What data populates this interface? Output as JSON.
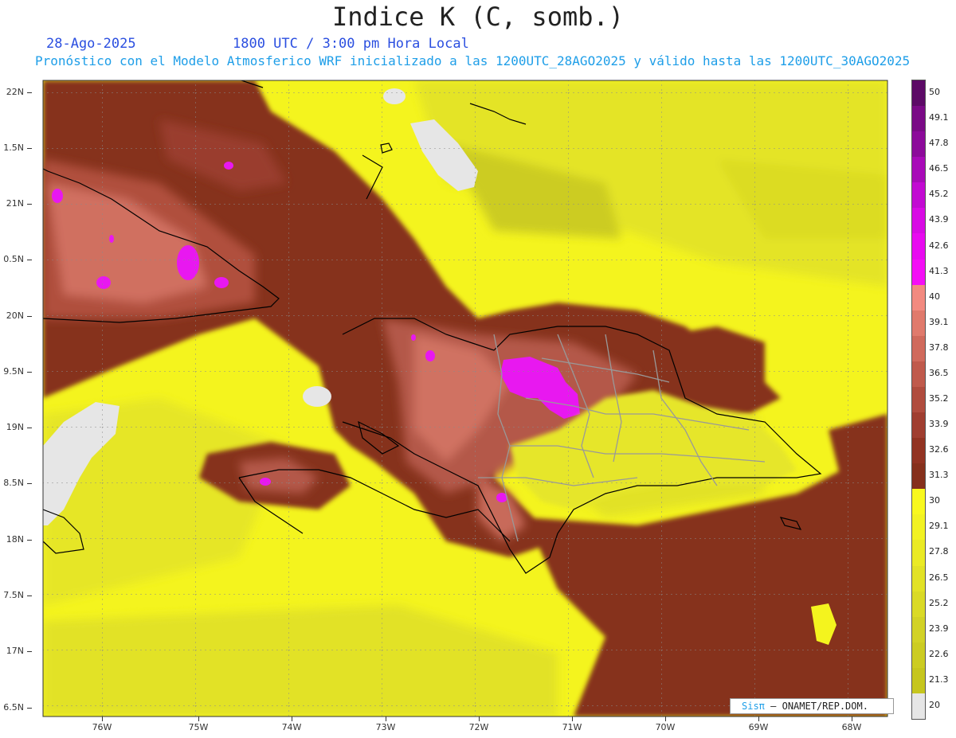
{
  "header": {
    "title": "Indice K (C, somb.)",
    "date": "28-Ago-2025",
    "time": "1800 UTC / 3:00 pm Hora Local",
    "subtitle": "Pronóstico con el Modelo Atmosferico WRF inicializado a las 1200UTC_28AGO2025 y válido hasta las  1200UTC_30AGO2025"
  },
  "axes": {
    "lat_labels": [
      "22N",
      "1.5N",
      "21N",
      "0.5N",
      "20N",
      "9.5N",
      "19N",
      "8.5N",
      "18N",
      "7.5N",
      "17N",
      "6.5N"
    ],
    "lon_labels": [
      "76W",
      "75W",
      "74W",
      "73W",
      "72W",
      "71W",
      "70W",
      "69W",
      "68W"
    ]
  },
  "legend": {
    "labels": [
      "50",
      "49.1",
      "47.8",
      "46.5",
      "45.2",
      "43.9",
      "42.6",
      "41.3",
      "40",
      "39.1",
      "37.8",
      "36.5",
      "35.2",
      "33.9",
      "32.6",
      "31.3",
      "30",
      "29.1",
      "27.8",
      "26.5",
      "25.2",
      "23.9",
      "22.6",
      "21.3",
      "20"
    ],
    "colors": [
      "#5c0a66",
      "#7a0a86",
      "#8c0a9a",
      "#a80ab8",
      "#c20ad2",
      "#d80ae4",
      "#e80af0",
      "#f40ef6",
      "#f28a80",
      "#e07a6c",
      "#d06a5c",
      "#c05a4c",
      "#b04c3e",
      "#a03e30",
      "#923322",
      "#86301c",
      "#f8f81e",
      "#f2f222",
      "#eaea24",
      "#e2e226",
      "#dada26",
      "#d2d226",
      "#cccc22",
      "#c6c61e",
      "#e6e6e6"
    ]
  },
  "map": {
    "colors": {
      "low": "#e6e6e6",
      "yellow": "#f6f61e",
      "yellow_dark": "#dada26",
      "brown": "#86301c",
      "brown_mid": "#a84a38",
      "salmon": "#d8786a",
      "magenta": "#e818f0",
      "coast": "#000000",
      "province": "#999999"
    }
  },
  "credit": {
    "sis": "Sisπ",
    "org": "– ONAMET/REP.DOM."
  }
}
